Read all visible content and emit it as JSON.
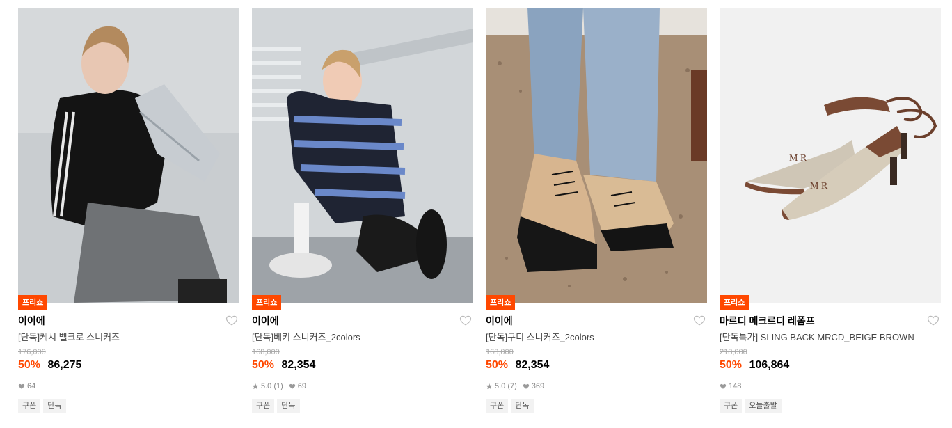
{
  "colors": {
    "accent": "#ff4800",
    "heart_icon": "#bbbbbb",
    "stat_icon": "#9a9a9a"
  },
  "products": [
    {
      "badge": "프리쇼",
      "brand": "이이에",
      "title": "[단독]케시 벨크로 스니커즈",
      "original_price": "176,000",
      "discount": "50%",
      "price": "86,275",
      "rating": "",
      "likes": "64",
      "tags": [
        "쿠폰",
        "단독"
      ],
      "image_subject": "model holding silver sneaker"
    },
    {
      "badge": "프리쇼",
      "brand": "이이에",
      "title": "[단독]베키 스니커즈_2colors",
      "original_price": "168,000",
      "discount": "50%",
      "price": "82,354",
      "rating": "5.0 (1)",
      "likes": "69",
      "tags": [
        "쿠폰",
        "단독"
      ],
      "image_subject": "model crouching in striped sweater"
    },
    {
      "badge": "프리쇼",
      "brand": "이이에",
      "title": "[단독]구디 스니커즈_2colors",
      "original_price": "168,000",
      "discount": "50%",
      "price": "82,354",
      "rating": "5.0 (7)",
      "likes": "369",
      "tags": [
        "쿠폰",
        "단독"
      ],
      "image_subject": "beige black sneakers on carpet"
    },
    {
      "badge": "프리쇼",
      "brand": "마르디 메크르디 레폼프",
      "title": "[단독특가] SLING BACK MRCD_BEIGE BROWN",
      "original_price": "218,000",
      "discount": "50%",
      "price": "106,864",
      "rating": "",
      "likes": "148",
      "tags": [
        "쿠폰",
        "오늘출발"
      ],
      "image_subject": "beige slingback heels"
    }
  ]
}
